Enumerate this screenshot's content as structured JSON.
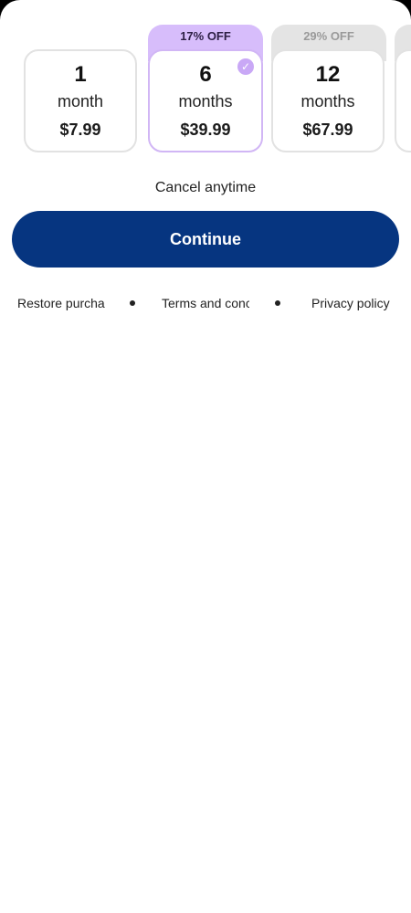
{
  "plans": [
    {
      "number": "1",
      "unit": "month",
      "price": "$7.99",
      "badge": ""
    },
    {
      "number": "6",
      "unit": "months",
      "price": "$39.99",
      "badge": "17% OFF"
    },
    {
      "number": "12",
      "unit": "months",
      "price": "$67.99",
      "badge": "29% OFF"
    }
  ],
  "selected_plan": "6 months",
  "cancel_text": "Cancel anytime",
  "continue_label": "Continue",
  "footer": {
    "restore": "Restore purchas",
    "terms": "Terms and conc",
    "privacy": "Privacy policy"
  },
  "colors": {
    "primary_button": "#063580",
    "selected_badge": "#d7bdfb",
    "muted_badge": "#e4e4e4"
  },
  "icons": {
    "selected_check": "check-circle-icon"
  }
}
